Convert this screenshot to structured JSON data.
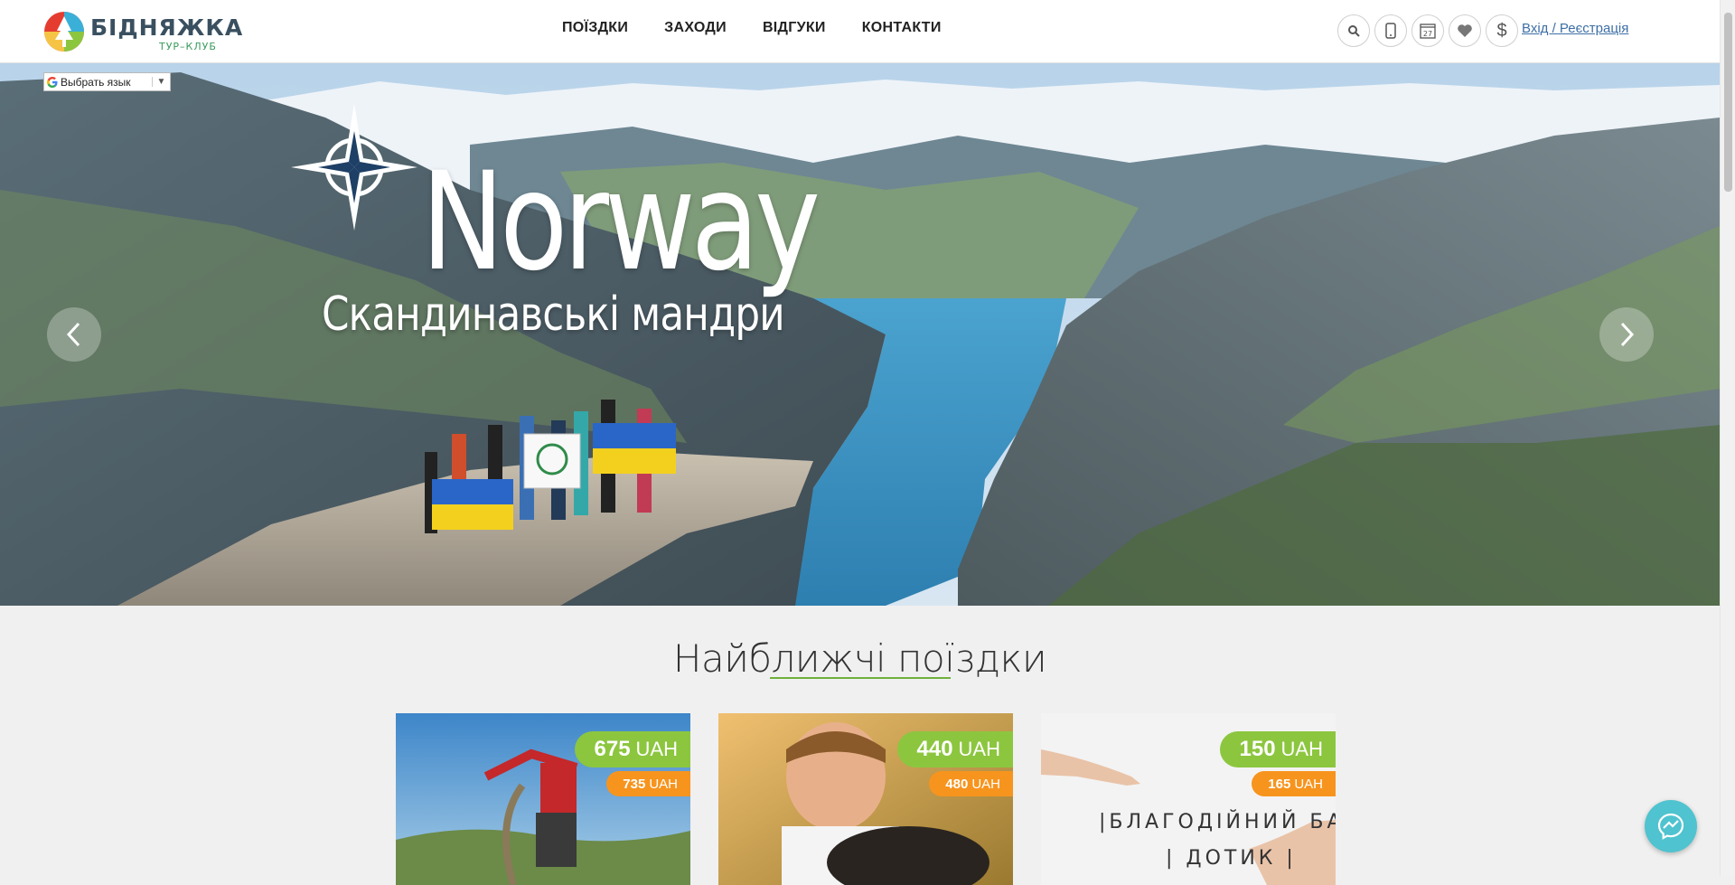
{
  "logo": {
    "name": "БІДНЯЖКА",
    "subtitle": "ТУР–КЛУБ"
  },
  "nav": [
    {
      "label": "ПОЇЗДКИ"
    },
    {
      "label": "ЗАХОДИ"
    },
    {
      "label": "ВІДГУКИ"
    },
    {
      "label": "КОНТАКТИ"
    }
  ],
  "tools": {
    "icons": [
      "search-icon",
      "phone-icon",
      "calendar-icon",
      "heart-icon",
      "dollar-icon"
    ],
    "calendar_day": "27",
    "login": "Вхід / Реєстрація"
  },
  "translate": {
    "label": "Выбрать язык",
    "arrow": "▼"
  },
  "hero": {
    "title": "Norway",
    "subtitle": "Скандинавські мандри",
    "prev_icon": "chevron-left-icon",
    "next_icon": "chevron-right-icon"
  },
  "section": {
    "title": "Найближчі поїздки"
  },
  "cards": [
    {
      "price": "675",
      "old_price": "735",
      "currency": "UAH"
    },
    {
      "price": "440",
      "old_price": "480",
      "currency": "UAH"
    },
    {
      "price": "150",
      "old_price": "165",
      "currency": "UAH",
      "text_line1": "|БЛАГОДІЙНИЙ БАЛ",
      "text_line2": "| ДОТИК |"
    }
  ],
  "colors": {
    "accent_green": "#8cc63f",
    "accent_orange": "#f7941d",
    "link_blue": "#3d6fa6",
    "messenger": "#4fc3cf"
  },
  "messenger": {
    "icon": "messenger-icon"
  }
}
